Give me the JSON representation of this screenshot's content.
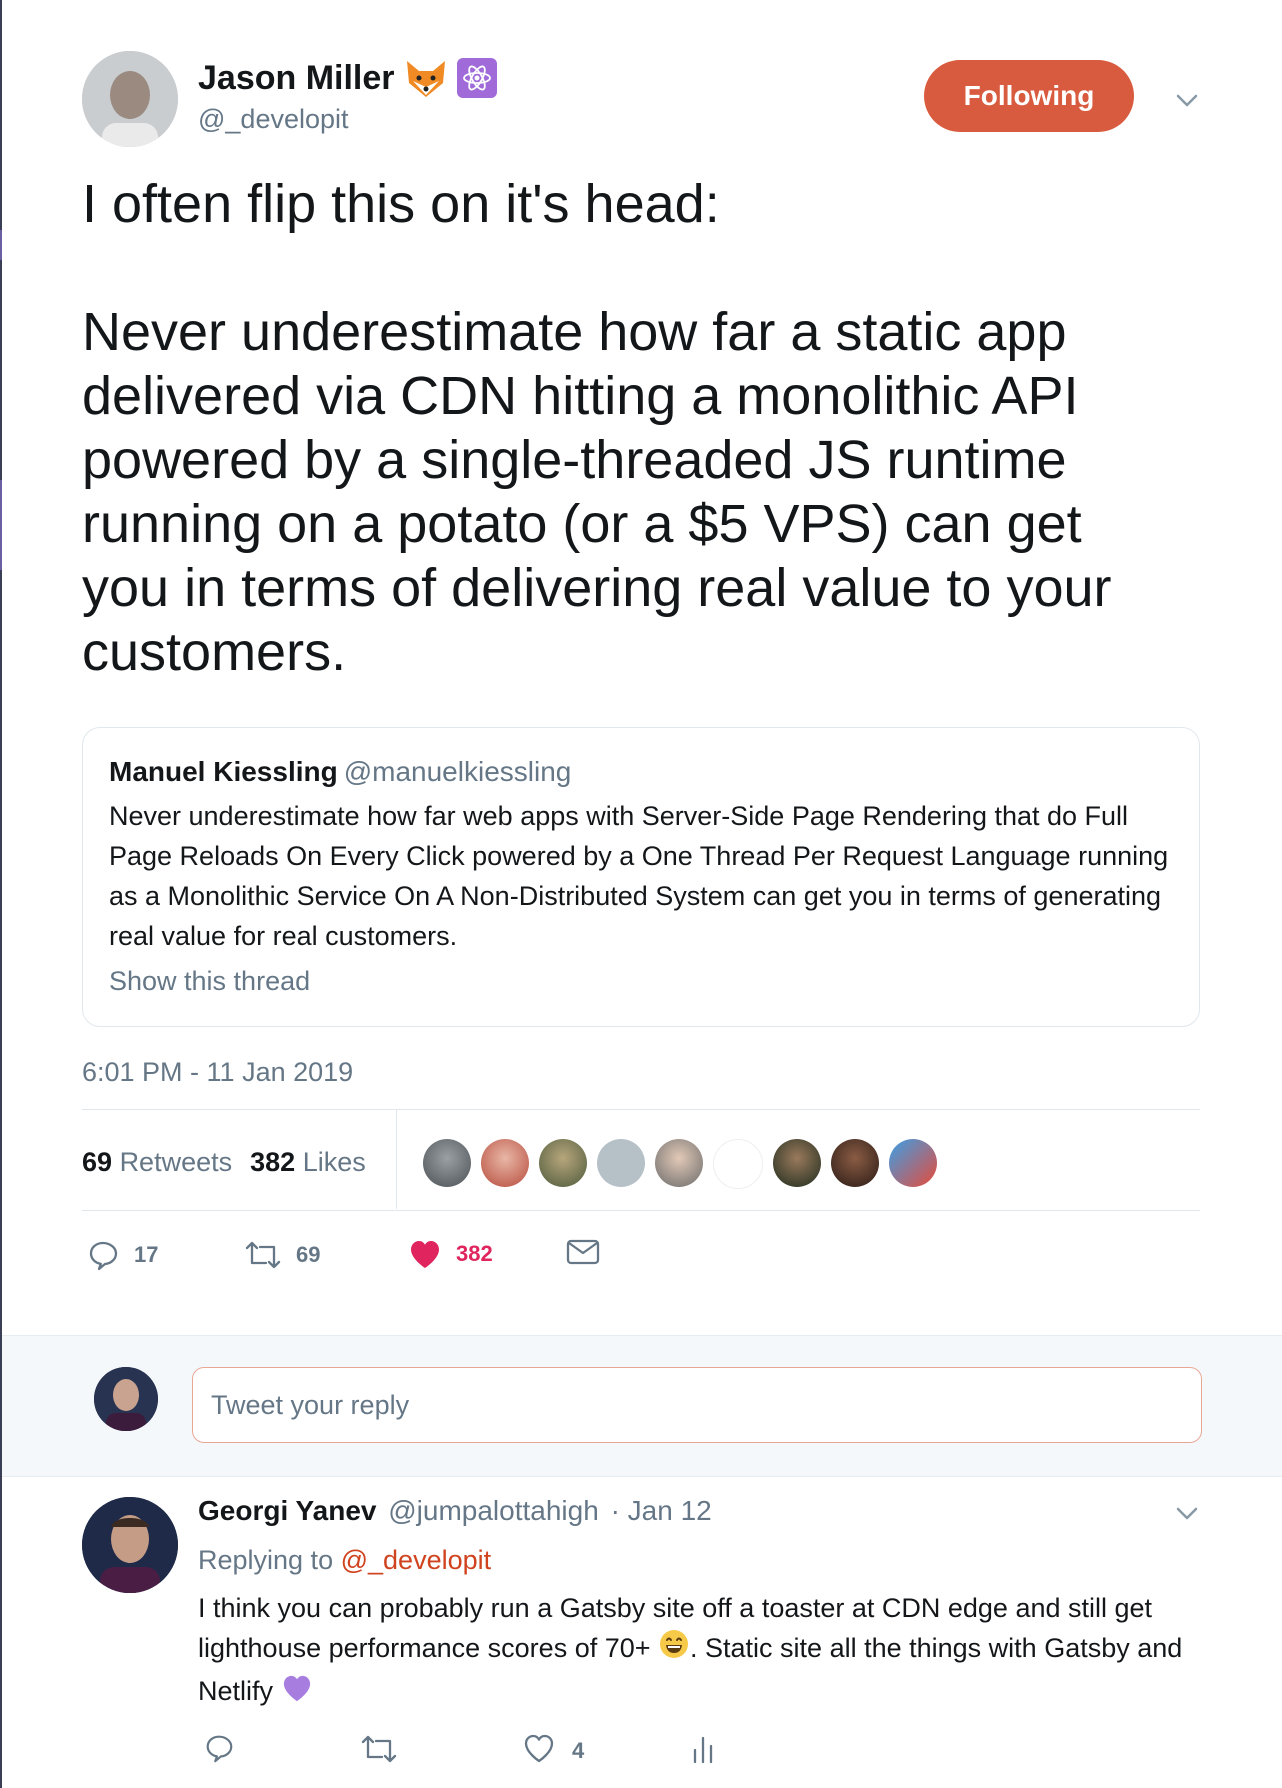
{
  "tweet": {
    "author_name": "Jason Miller",
    "author_handle": "@_developit",
    "badges": [
      "fox-emoji-icon",
      "react-atom-icon"
    ],
    "follow_label": "Following",
    "text": "I often flip this on it's head:\n\nNever underestimate how far a static app delivered via CDN hitting a monolithic API powered by a single-threaded JS runtime running on a potato (or a $5 VPS) can get you in terms of delivering real value to your customers.",
    "timestamp": "6:01 PM - 11 Jan 2019"
  },
  "quote": {
    "author_name": "Manuel Kiessling",
    "author_handle": "@manuelkiessling",
    "text": "Never underestimate how far web apps with Server-Side Page Rendering that do Full Page Reloads On Every Click powered by a One Thread Per Request Language running as a Monolithic Service On A Non-Distributed System can get you in terms of generating real value for real customers.",
    "show_thread": "Show this thread"
  },
  "stats": {
    "retweets_count": "69",
    "retweets_label": "Retweets",
    "likes_count": "382",
    "likes_label": "Likes"
  },
  "actions": {
    "replies": "17",
    "retweets": "69",
    "likes": "382"
  },
  "compose": {
    "placeholder": "Tweet your reply"
  },
  "reply": {
    "author_name": "Georgi Yanev",
    "author_handle": "@jumpalottahigh",
    "date": "· Jan 12",
    "replying_prefix": "Replying to",
    "replying_to": "@_developit",
    "text_part1": "I think you can probably run a Gatsby site off a toaster at CDN edge and still get lighthouse performance scores of 70+",
    "text_part2": ". Static site all the things with Gatsby and Netlify",
    "likes": "4"
  },
  "colors": {
    "accent": "#d95b3f",
    "like_red": "#e0245e",
    "muted": "#657786",
    "text": "#14171a"
  }
}
